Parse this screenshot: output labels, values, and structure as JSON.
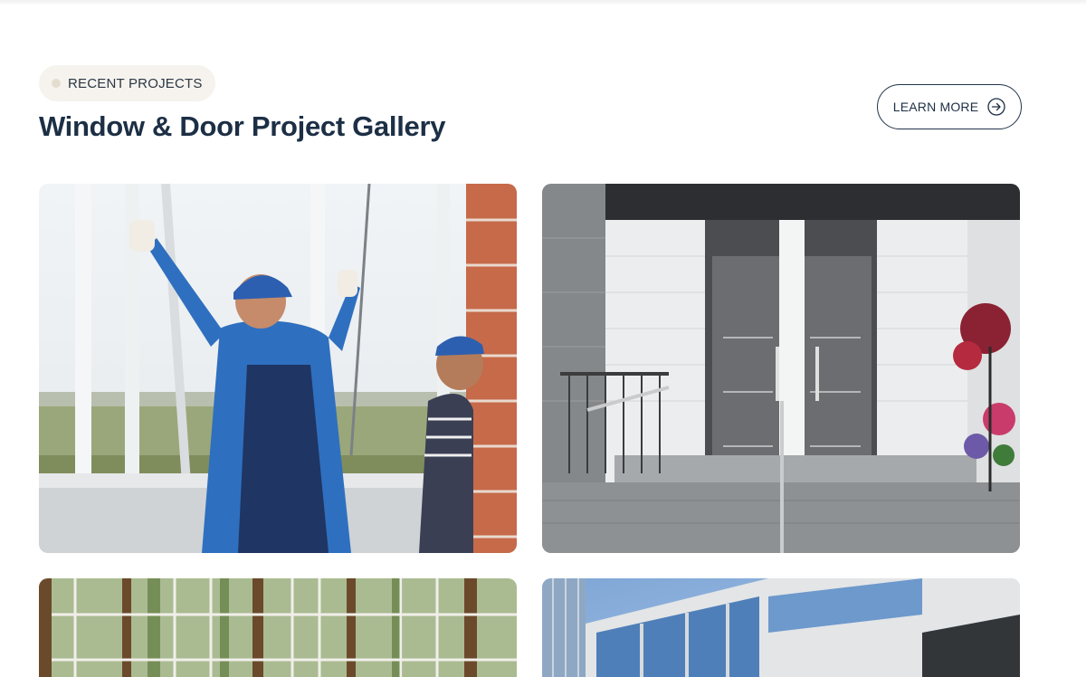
{
  "section": {
    "eyebrow": "RECENT PROJECTS",
    "title": "Window & Door Project Gallery",
    "learn_more_label": "LEARN MORE",
    "learn_more_icon": "arrow-right-circle-icon"
  },
  "gallery": {
    "items": [
      {
        "image": "workers-installing-window-photo"
      },
      {
        "image": "modern-entrance-doors-photo"
      },
      {
        "image": "wooden-window-frames-photo"
      },
      {
        "image": "glass-building-facade-photo"
      }
    ]
  },
  "colors": {
    "heading": "#1c2f45",
    "eyebrow_bg": "#f6f3ee",
    "button_border": "#22344a"
  }
}
